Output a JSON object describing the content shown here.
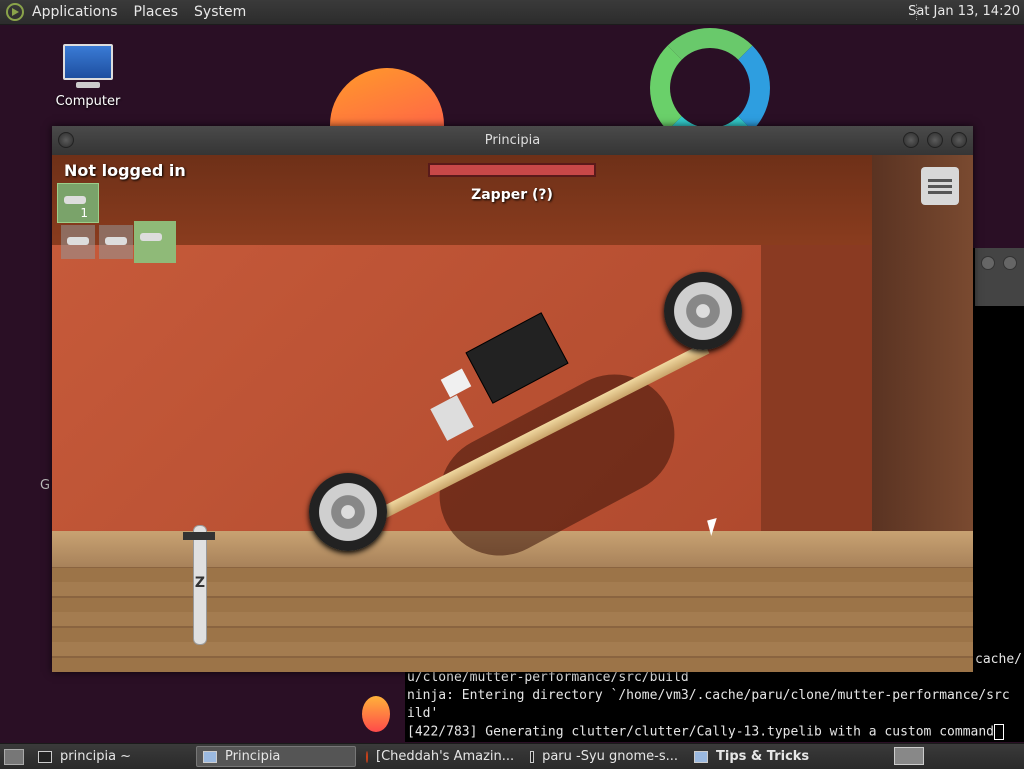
{
  "top_panel": {
    "menus": [
      "Applications",
      "Places",
      "System"
    ],
    "clock": "Sat Jan 13, 14:20"
  },
  "desktop": {
    "icons": [
      {
        "label": "Computer",
        "icon": "computer-icon"
      }
    ],
    "stray_text": "G"
  },
  "terminal": {
    "right_fragment": "cache/",
    "lines": [
      "u/clone/mutter-performance/src/build",
      "ninja: Entering directory `/home/vm3/.cache/paru/clone/mutter-performance/src",
      "ild'",
      "[422/783] Generating clutter/clutter/Cally-13.typelib with a custom command"
    ]
  },
  "principia": {
    "title": "Principia",
    "user_status": "Not logged in",
    "selected_tool_number": "1",
    "object_label": "Zapper (?)",
    "z_label": "Z"
  },
  "taskbar": {
    "items": [
      {
        "label": "principia ~",
        "icon": "terminal-icon",
        "active": false
      },
      {
        "label": "Principia",
        "icon": "window-icon",
        "active": true
      },
      {
        "label": "[Cheddah's Amazin...",
        "icon": "firefox-icon",
        "active": false
      },
      {
        "label": "paru -Syu gnome-s...",
        "icon": "terminal-icon",
        "active": false
      },
      {
        "label": "Tips & Tricks",
        "icon": "window-icon",
        "active": false
      }
    ]
  }
}
